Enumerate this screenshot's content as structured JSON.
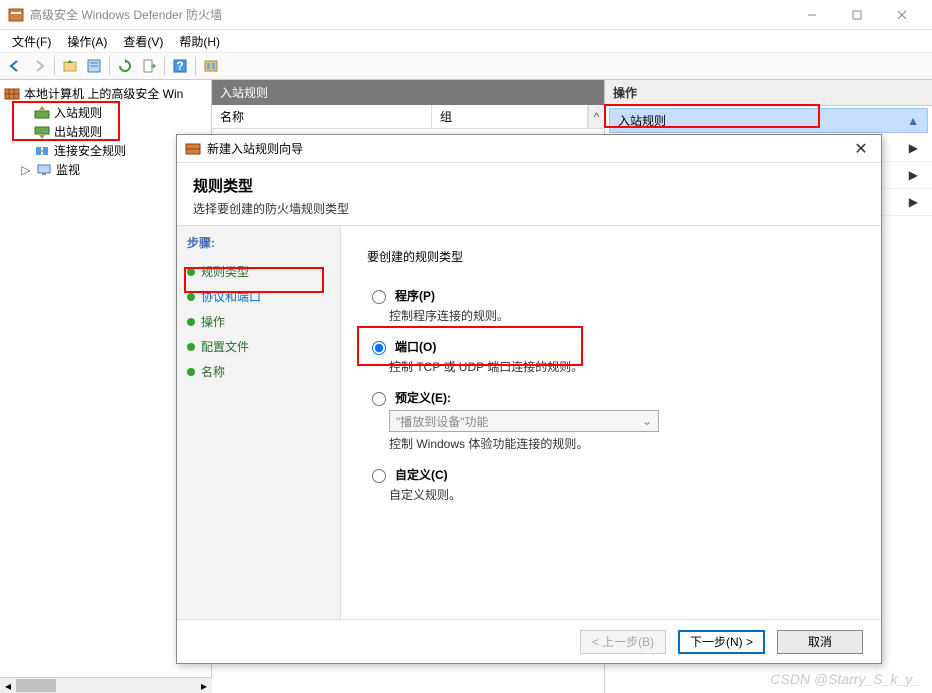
{
  "window": {
    "title": "高级安全 Windows Defender 防火墙"
  },
  "menu": {
    "file": "文件(F)",
    "action": "操作(A)",
    "view": "查看(V)",
    "help": "帮助(H)"
  },
  "tree": {
    "root": "本地计算机 上的高级安全 Win",
    "inbound": "入站规则",
    "outbound": "出站规则",
    "connsec": "连接安全规则",
    "monitor": "监视"
  },
  "center": {
    "header": "入站规则",
    "col_name": "名称",
    "col_group": "组"
  },
  "right": {
    "header": "操作",
    "action_inbound": "入站规则"
  },
  "wizard": {
    "title": "新建入站规则向导",
    "heading": "规则类型",
    "subheading": "选择要创建的防火墙规则类型",
    "steps_label": "步骤:",
    "steps": {
      "type": "规则类型",
      "protocol": "协议和端口",
      "action": "操作",
      "profile": "配置文件",
      "name": "名称"
    },
    "question": "要创建的规则类型",
    "options": {
      "program": {
        "label": "程序(P)",
        "desc": "控制程序连接的规则。"
      },
      "port": {
        "label": "端口(O)",
        "desc": "控制 TCP 或 UDP 端口连接的规则。"
      },
      "predefined": {
        "label": "预定义(E):",
        "combo": "\"播放到设备\"功能",
        "desc": "控制 Windows 体验功能连接的规则。"
      },
      "custom": {
        "label": "自定义(C)",
        "desc": "自定义规则。"
      }
    },
    "buttons": {
      "back": "< 上一步(B)",
      "next": "下一步(N) >",
      "cancel": "取消"
    }
  },
  "watermark": "CSDN @Starry_S_k_y_"
}
